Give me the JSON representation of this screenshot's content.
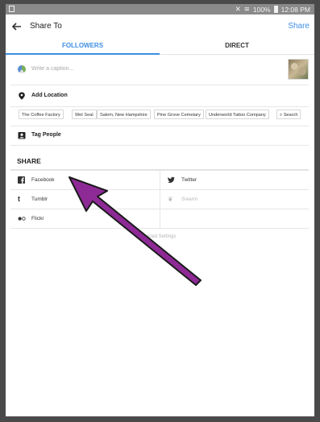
{
  "status_bar": {
    "battery": "100%",
    "time": "12:08 PM"
  },
  "header": {
    "title": "Share To",
    "action": "Share"
  },
  "tabs": [
    {
      "label": "FOLLOWERS",
      "active": true
    },
    {
      "label": "DIRECT",
      "active": false
    }
  ],
  "caption": {
    "placeholder": "Write a caption..."
  },
  "add_location": {
    "label": "Add Location"
  },
  "location_suggestions": [
    "The Coffee Factory",
    "Wet Seal",
    "Salem, New Hampshire",
    "Pine Grove Cemetary",
    "Underworld Tattoo Company",
    "Search"
  ],
  "tag_people": {
    "label": "Tag People"
  },
  "share_section": {
    "heading": "SHARE",
    "options": [
      {
        "label": "Facebook",
        "icon": "facebook-icon",
        "enabled": true
      },
      {
        "label": "Twitter",
        "icon": "twitter-icon",
        "enabled": true
      },
      {
        "label": "Tumblr",
        "icon": "tumblr-icon",
        "enabled": true
      },
      {
        "label": "Swarm",
        "icon": "swarm-icon",
        "enabled": false
      },
      {
        "label": "Flickr",
        "icon": "flickr-icon",
        "enabled": true
      }
    ]
  },
  "advanced_settings": {
    "label": "anced Settings"
  },
  "colors": {
    "accent": "#3d8fe5",
    "annotation_arrow": "#8e2a96"
  }
}
